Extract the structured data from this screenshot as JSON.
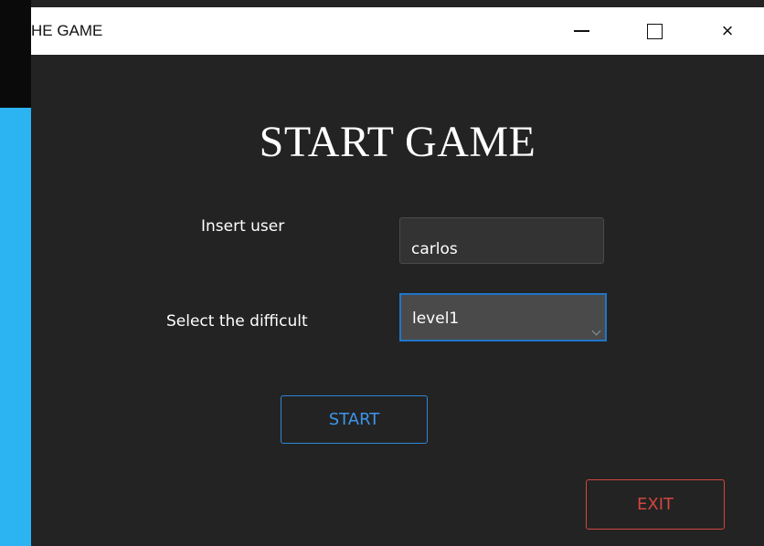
{
  "window": {
    "title": "HE GAME",
    "controls": {
      "minimize": "minimize",
      "maximize": "maximize",
      "close": "×"
    }
  },
  "main": {
    "heading": "START GAME",
    "user_label": "Insert user",
    "user_value": "carlos",
    "difficulty_label": "Select the difficult",
    "difficulty_value": "level1",
    "start_label": "START",
    "exit_label": "EXIT"
  },
  "colors": {
    "window_bg": "#232323",
    "accent_blue": "#1e76c9",
    "exit_red": "#d2463f",
    "desktop_blue": "#2bb3f2"
  },
  "icons": {
    "minimize": "minimize-icon",
    "maximize": "maximize-icon",
    "close": "close-icon",
    "dropdown": "chevron-down-icon"
  }
}
